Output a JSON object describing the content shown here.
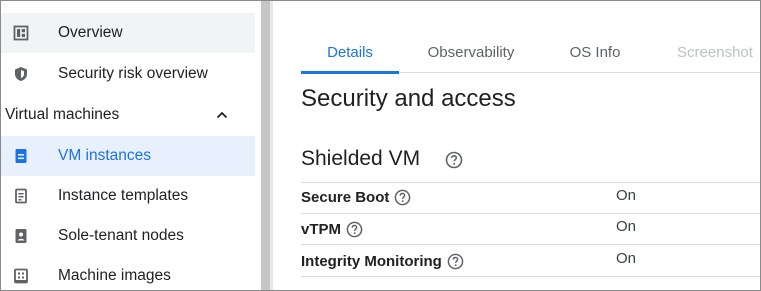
{
  "sidebar": {
    "items": [
      {
        "label": "Overview",
        "icon": "dashboard-icon"
      },
      {
        "label": "Security risk overview",
        "icon": "shield-icon"
      },
      {
        "label": "VM instances",
        "icon": "vm-instance-icon"
      },
      {
        "label": "Instance templates",
        "icon": "template-icon"
      },
      {
        "label": "Sole-tenant nodes",
        "icon": "sole-tenant-icon"
      },
      {
        "label": "Machine images",
        "icon": "machine-image-icon"
      }
    ],
    "section": {
      "label": "Virtual machines",
      "icon": "chevron-up-icon"
    }
  },
  "tabs": [
    {
      "label": "Details",
      "state": "active"
    },
    {
      "label": "Observability",
      "state": "normal"
    },
    {
      "label": "OS Info",
      "state": "normal"
    },
    {
      "label": "Screenshot",
      "state": "disabled"
    }
  ],
  "main": {
    "title": "Security and access",
    "section_title": "Shielded VM",
    "rows": [
      {
        "label": "Secure Boot",
        "value": "On"
      },
      {
        "label": "vTPM",
        "value": "On"
      },
      {
        "label": "Integrity Monitoring",
        "value": "On"
      }
    ]
  },
  "colors": {
    "accent": "#1a73e8",
    "active_bg": "#e8f0fe",
    "hover_bg": "#f1f3f4",
    "icon": "#5f6368"
  }
}
